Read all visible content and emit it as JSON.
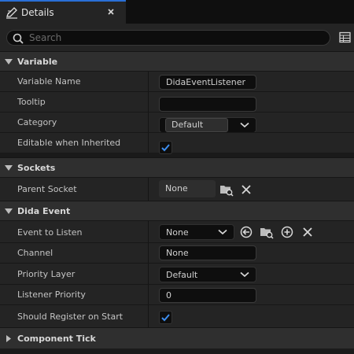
{
  "tab": {
    "title": "Details"
  },
  "search": {
    "placeholder": "Search",
    "value": ""
  },
  "sections": {
    "variable": {
      "title": "Variable",
      "rows": {
        "name": {
          "label": "Variable Name",
          "value": "DidaEventListener"
        },
        "tooltip": {
          "label": "Tooltip",
          "value": ""
        },
        "category": {
          "label": "Category",
          "value": "Default"
        },
        "editable": {
          "label": "Editable when Inherited",
          "checked": true
        }
      }
    },
    "sockets": {
      "title": "Sockets",
      "rows": {
        "parent_socket": {
          "label": "Parent Socket",
          "value": "None"
        }
      }
    },
    "dida_event": {
      "title": "Dida Event",
      "rows": {
        "event_to_listen": {
          "label": "Event to Listen",
          "value": "None"
        },
        "channel": {
          "label": "Channel",
          "value": "None"
        },
        "priority_layer": {
          "label": "Priority Layer",
          "value": "Default"
        },
        "listener_priority": {
          "label": "Listener Priority",
          "value": "0"
        },
        "register_on_start": {
          "label": "Should Register on Start",
          "checked": true
        }
      }
    },
    "component_tick": {
      "title": "Component Tick"
    }
  },
  "icons": {
    "tab": "pencil-details-icon",
    "close": "close-icon",
    "search": "search-icon",
    "columns": "table-icon",
    "browse": "browse-folder-icon",
    "clear": "clear-x-icon",
    "use_selected": "use-selected-arrow-icon",
    "add": "add-circle-icon"
  },
  "colors": {
    "accent": "#2a6fd6",
    "panel": "#242424",
    "header": "#2f2f2f",
    "field": "#0e0e0e"
  }
}
